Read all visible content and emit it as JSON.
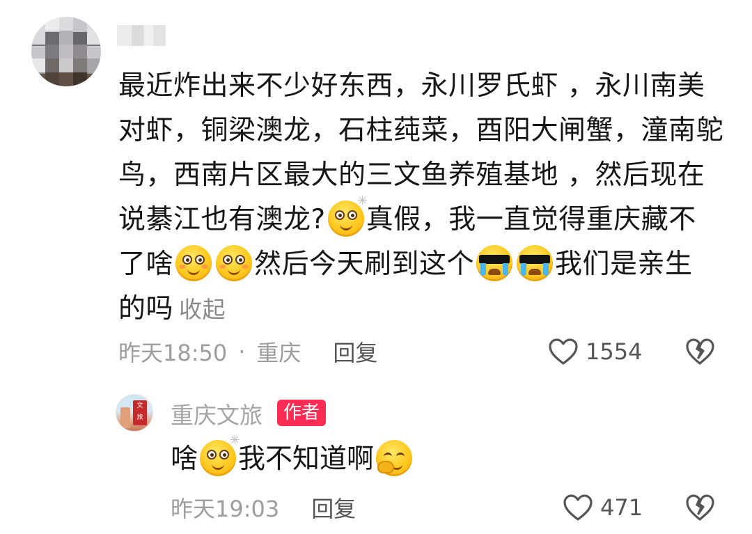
{
  "comment": {
    "lines": [
      "最近炸出来不少好东西，永川罗氏虾 ，永川南美",
      "对虾，铜梁澳龙，石柱莼菜，酉阳大闸蟹，潼南鸵",
      "鸟，西南片区最大的三文鱼养殖基地 ，然后现在"
    ],
    "line4_a": "说綦江也有澳龙?",
    "line4_b": "真假，我一直觉得重庆藏不",
    "line5_a": "了啥",
    "line5_b": "然后今天刷到这个",
    "line5_c": "我们是亲生",
    "line6": "的吗",
    "collapse_label": "收起",
    "time": "昨天18:50",
    "separator": "·",
    "location": "重庆",
    "reply_label": "回复",
    "like_count": "1554"
  },
  "reply": {
    "author": "重庆文旅",
    "author_badge": "作者",
    "text_a": "啥",
    "text_b": "我不知道啊",
    "time": "昨天19:03",
    "reply_label": "回复",
    "like_count": "471"
  },
  "icons": {
    "heart": "heart-outline-icon",
    "dislike": "broken-heart-icon"
  },
  "colors": {
    "badge": "#fd2c55",
    "muted": "#9d9d9d",
    "text": "#161616"
  }
}
